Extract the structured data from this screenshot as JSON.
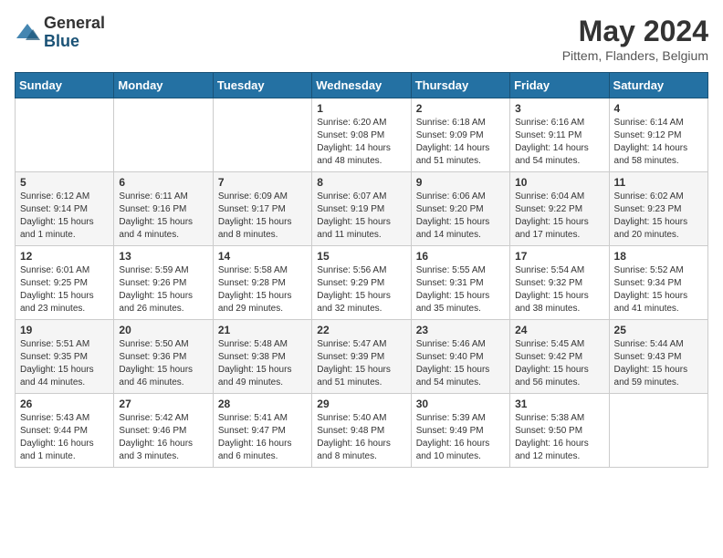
{
  "header": {
    "logo_general": "General",
    "logo_blue": "Blue",
    "month_title": "May 2024",
    "location": "Pittem, Flanders, Belgium"
  },
  "days_of_week": [
    "Sunday",
    "Monday",
    "Tuesday",
    "Wednesday",
    "Thursday",
    "Friday",
    "Saturday"
  ],
  "weeks": [
    [
      {
        "day": "",
        "content": ""
      },
      {
        "day": "",
        "content": ""
      },
      {
        "day": "",
        "content": ""
      },
      {
        "day": "1",
        "content": "Sunrise: 6:20 AM\nSunset: 9:08 PM\nDaylight: 14 hours\nand 48 minutes."
      },
      {
        "day": "2",
        "content": "Sunrise: 6:18 AM\nSunset: 9:09 PM\nDaylight: 14 hours\nand 51 minutes."
      },
      {
        "day": "3",
        "content": "Sunrise: 6:16 AM\nSunset: 9:11 PM\nDaylight: 14 hours\nand 54 minutes."
      },
      {
        "day": "4",
        "content": "Sunrise: 6:14 AM\nSunset: 9:12 PM\nDaylight: 14 hours\nand 58 minutes."
      }
    ],
    [
      {
        "day": "5",
        "content": "Sunrise: 6:12 AM\nSunset: 9:14 PM\nDaylight: 15 hours\nand 1 minute."
      },
      {
        "day": "6",
        "content": "Sunrise: 6:11 AM\nSunset: 9:16 PM\nDaylight: 15 hours\nand 4 minutes."
      },
      {
        "day": "7",
        "content": "Sunrise: 6:09 AM\nSunset: 9:17 PM\nDaylight: 15 hours\nand 8 minutes."
      },
      {
        "day": "8",
        "content": "Sunrise: 6:07 AM\nSunset: 9:19 PM\nDaylight: 15 hours\nand 11 minutes."
      },
      {
        "day": "9",
        "content": "Sunrise: 6:06 AM\nSunset: 9:20 PM\nDaylight: 15 hours\nand 14 minutes."
      },
      {
        "day": "10",
        "content": "Sunrise: 6:04 AM\nSunset: 9:22 PM\nDaylight: 15 hours\nand 17 minutes."
      },
      {
        "day": "11",
        "content": "Sunrise: 6:02 AM\nSunset: 9:23 PM\nDaylight: 15 hours\nand 20 minutes."
      }
    ],
    [
      {
        "day": "12",
        "content": "Sunrise: 6:01 AM\nSunset: 9:25 PM\nDaylight: 15 hours\nand 23 minutes."
      },
      {
        "day": "13",
        "content": "Sunrise: 5:59 AM\nSunset: 9:26 PM\nDaylight: 15 hours\nand 26 minutes."
      },
      {
        "day": "14",
        "content": "Sunrise: 5:58 AM\nSunset: 9:28 PM\nDaylight: 15 hours\nand 29 minutes."
      },
      {
        "day": "15",
        "content": "Sunrise: 5:56 AM\nSunset: 9:29 PM\nDaylight: 15 hours\nand 32 minutes."
      },
      {
        "day": "16",
        "content": "Sunrise: 5:55 AM\nSunset: 9:31 PM\nDaylight: 15 hours\nand 35 minutes."
      },
      {
        "day": "17",
        "content": "Sunrise: 5:54 AM\nSunset: 9:32 PM\nDaylight: 15 hours\nand 38 minutes."
      },
      {
        "day": "18",
        "content": "Sunrise: 5:52 AM\nSunset: 9:34 PM\nDaylight: 15 hours\nand 41 minutes."
      }
    ],
    [
      {
        "day": "19",
        "content": "Sunrise: 5:51 AM\nSunset: 9:35 PM\nDaylight: 15 hours\nand 44 minutes."
      },
      {
        "day": "20",
        "content": "Sunrise: 5:50 AM\nSunset: 9:36 PM\nDaylight: 15 hours\nand 46 minutes."
      },
      {
        "day": "21",
        "content": "Sunrise: 5:48 AM\nSunset: 9:38 PM\nDaylight: 15 hours\nand 49 minutes."
      },
      {
        "day": "22",
        "content": "Sunrise: 5:47 AM\nSunset: 9:39 PM\nDaylight: 15 hours\nand 51 minutes."
      },
      {
        "day": "23",
        "content": "Sunrise: 5:46 AM\nSunset: 9:40 PM\nDaylight: 15 hours\nand 54 minutes."
      },
      {
        "day": "24",
        "content": "Sunrise: 5:45 AM\nSunset: 9:42 PM\nDaylight: 15 hours\nand 56 minutes."
      },
      {
        "day": "25",
        "content": "Sunrise: 5:44 AM\nSunset: 9:43 PM\nDaylight: 15 hours\nand 59 minutes."
      }
    ],
    [
      {
        "day": "26",
        "content": "Sunrise: 5:43 AM\nSunset: 9:44 PM\nDaylight: 16 hours\nand 1 minute."
      },
      {
        "day": "27",
        "content": "Sunrise: 5:42 AM\nSunset: 9:46 PM\nDaylight: 16 hours\nand 3 minutes."
      },
      {
        "day": "28",
        "content": "Sunrise: 5:41 AM\nSunset: 9:47 PM\nDaylight: 16 hours\nand 6 minutes."
      },
      {
        "day": "29",
        "content": "Sunrise: 5:40 AM\nSunset: 9:48 PM\nDaylight: 16 hours\nand 8 minutes."
      },
      {
        "day": "30",
        "content": "Sunrise: 5:39 AM\nSunset: 9:49 PM\nDaylight: 16 hours\nand 10 minutes."
      },
      {
        "day": "31",
        "content": "Sunrise: 5:38 AM\nSunset: 9:50 PM\nDaylight: 16 hours\nand 12 minutes."
      },
      {
        "day": "",
        "content": ""
      }
    ]
  ]
}
